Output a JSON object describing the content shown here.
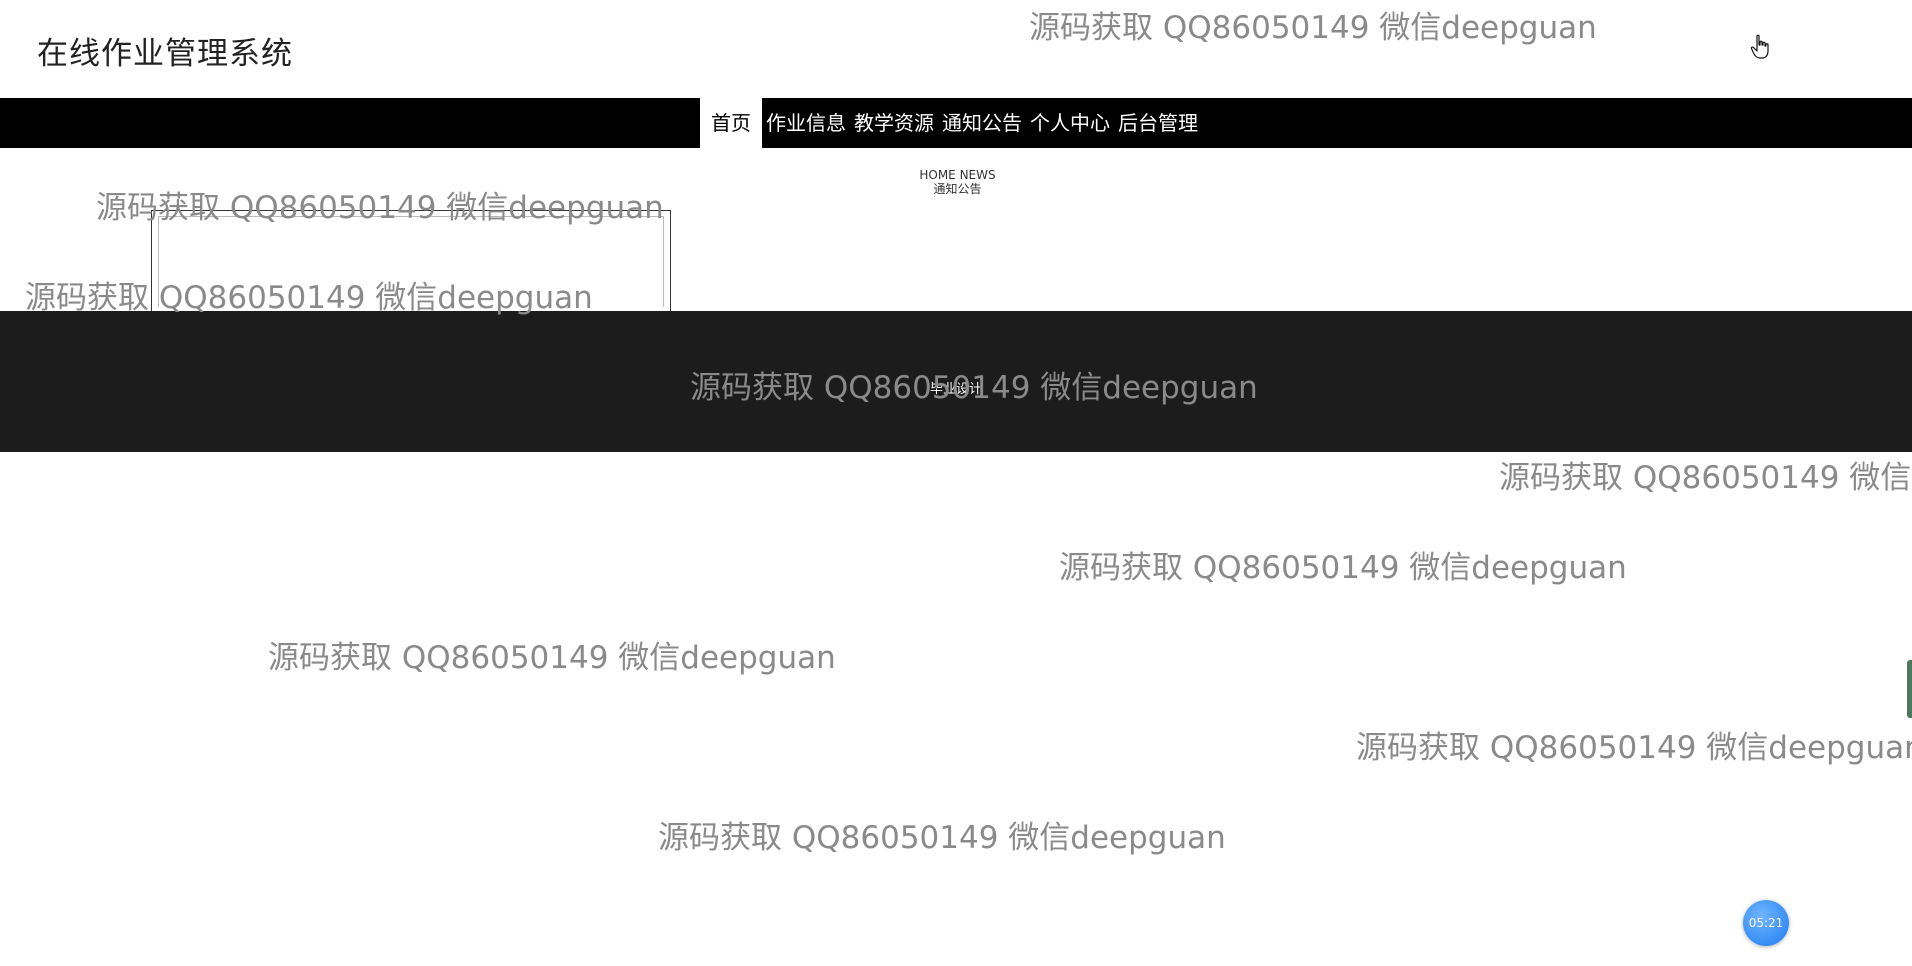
{
  "header": {
    "title": "在线作业管理系统"
  },
  "nav": {
    "items": [
      {
        "label": "首页",
        "active": true
      },
      {
        "label": "作业信息",
        "active": false
      },
      {
        "label": "教学资源",
        "active": false
      },
      {
        "label": "通知公告",
        "active": false
      },
      {
        "label": "个人中心",
        "active": false
      },
      {
        "label": "后台管理",
        "active": false
      }
    ]
  },
  "news": {
    "en_title": "HOME NEWS",
    "cn_title": "通知公告"
  },
  "banner": {
    "text": "毕业设计"
  },
  "watermark": {
    "text": "源码获取 QQ86050149 微信deepguan"
  },
  "timer": {
    "label": "05:21"
  },
  "colors": {
    "nav_bg": "#000000",
    "band_bg": "#1c1c1c",
    "watermark": "#8a8a8a",
    "timer": "#1e7cf0"
  },
  "icons": {
    "cursor": "hand-pointer-icon"
  }
}
